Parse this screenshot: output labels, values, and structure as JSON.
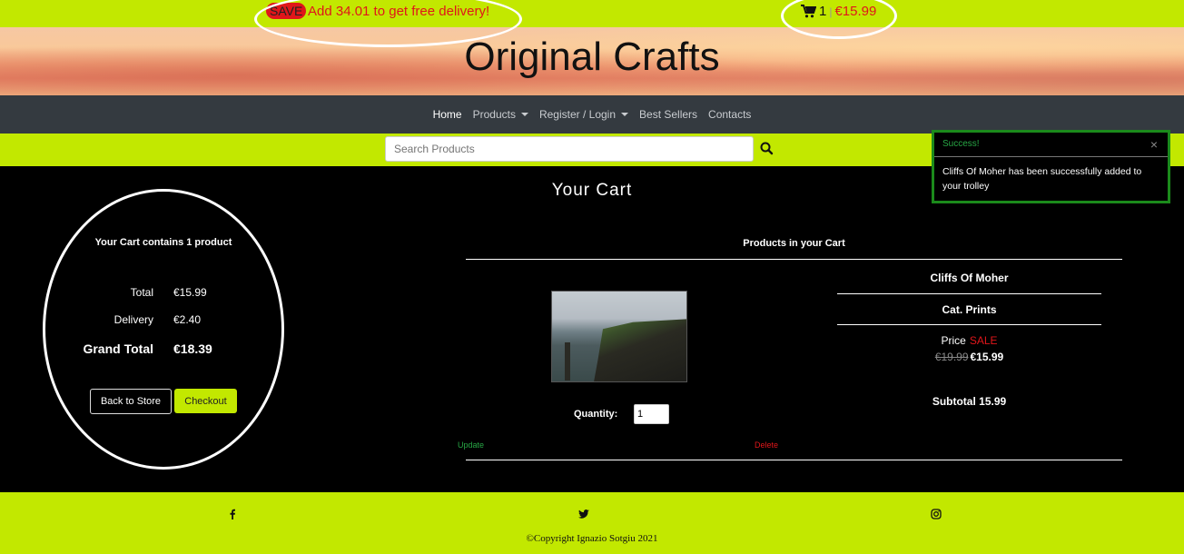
{
  "top_bar": {
    "save_label": "SAVE",
    "delivery_text": "Add 34.01 to get free delivery!",
    "cart_count": "1",
    "cart_separator": "|",
    "cart_total": "€15.99"
  },
  "hero": {
    "title": "Original Crafts"
  },
  "nav": {
    "items": [
      {
        "label": "Home"
      },
      {
        "label": "Products"
      },
      {
        "label": "Register / Login"
      },
      {
        "label": "Best Sellers"
      },
      {
        "label": "Contacts"
      }
    ]
  },
  "search": {
    "placeholder": "Search Products",
    "value": ""
  },
  "main": {
    "heading": "Your Cart"
  },
  "summary": {
    "title": "Your Cart contains 1 product",
    "total_label": "Total",
    "total_value": "€15.99",
    "delivery_label": "Delivery",
    "delivery_value": "€2.40",
    "grand_label": "Grand Total",
    "grand_value": "€18.39",
    "back_label": "Back to Store",
    "checkout_label": "Checkout"
  },
  "products": {
    "header": "Products in your Cart",
    "items": [
      {
        "name": "Cliffs Of Moher",
        "category": "Cat. Prints",
        "price_label": "Price",
        "sale_label": "SALE",
        "old_price": "€19.99",
        "price": "€15.99",
        "subtotal": "Subtotal 15.99",
        "quantity_label": "Quantity:",
        "quantity": "1",
        "update_label": "Update",
        "delete_label": "Delete"
      }
    ]
  },
  "toast": {
    "title": "Success!",
    "close": "×",
    "message": "Cliffs Of Moher has been successfully added to your trolley"
  },
  "footer": {
    "copyright": "©Copyright Ignazio Sotgiu 2021"
  },
  "colors": {
    "accent": "#c2e800",
    "sale": "#e0161a",
    "success": "#28a745",
    "nav_bg": "#343a40"
  }
}
